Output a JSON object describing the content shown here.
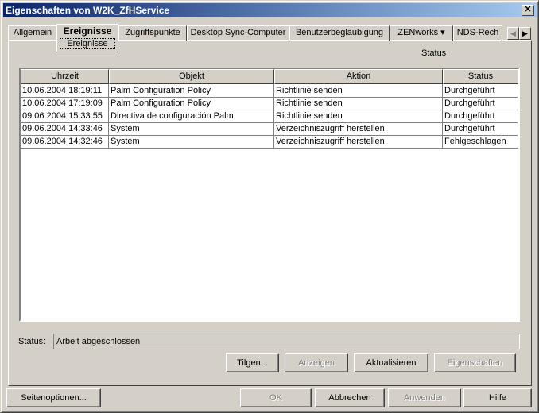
{
  "window": {
    "title": "Eigenschaften von W2K_ZfHService",
    "close": "✕"
  },
  "tabs": [
    {
      "label": "Allgemein"
    },
    {
      "label": "Ereignisse",
      "sub": "Ereignisse"
    },
    {
      "label": "Zugriffspunkte"
    },
    {
      "label": "Desktop Sync-Computer"
    },
    {
      "label": "Benutzerbeglaubigung"
    },
    {
      "label": "ZENworks ▾"
    },
    {
      "label": "NDS-Rech"
    }
  ],
  "tab_scroll": {
    "left": "◀",
    "right": "▶"
  },
  "panel_heading": "Status",
  "table": {
    "columns": [
      "Uhrzeit",
      "Objekt",
      "Aktion",
      "Status"
    ],
    "rows": [
      [
        "10.06.2004 18:19:11",
        "Palm Configuration Policy",
        "Richtlinie senden",
        "Durchgeführt"
      ],
      [
        "10.06.2004 17:19:09",
        "Palm Configuration Policy",
        "Richtlinie senden",
        "Durchgeführt"
      ],
      [
        "09.06.2004 15:33:55",
        "Directiva de configuración Palm",
        "Richtlinie senden",
        "Durchgeführt"
      ],
      [
        "09.06.2004 14:33:46",
        "System",
        "Verzeichniszugriff herstellen",
        "Durchgeführt"
      ],
      [
        "09.06.2004 14:32:46",
        "System",
        "Verzeichniszugriff herstellen",
        "Fehlgeschlagen"
      ]
    ]
  },
  "status": {
    "label": "Status:",
    "value": "Arbeit abgeschlossen"
  },
  "actions": {
    "tilgen": "Tilgen...",
    "anzeigen": "Anzeigen",
    "aktualisieren": "Aktualisieren",
    "eigenschaften": "Eigenschaften"
  },
  "footer": {
    "seitenoptionen": "Seitenoptionen...",
    "ok": "OK",
    "abbrechen": "Abbrechen",
    "anwenden": "Anwenden",
    "hilfe": "Hilfe"
  }
}
